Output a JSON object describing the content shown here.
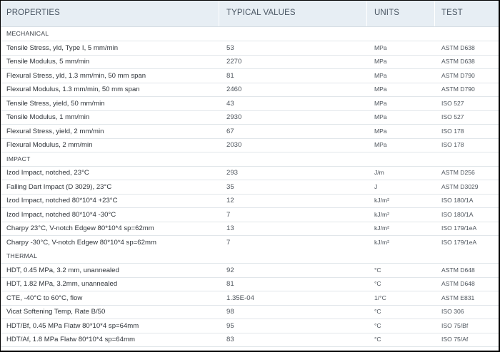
{
  "header": {
    "properties": "PROPERTIES",
    "typical_values": "TYPICAL VALUES",
    "units": "UNITS",
    "test_methods": "TEST METHODS"
  },
  "sections": [
    {
      "name": "MECHANICAL",
      "rows": [
        {
          "property": "Tensile Stress, yld, Type I, 5 mm/min",
          "value": "53",
          "unit": "MPa",
          "method": "ASTM D638"
        },
        {
          "property": "Tensile Modulus, 5 mm/min",
          "value": "2270",
          "unit": "MPa",
          "method": "ASTM D638"
        },
        {
          "property": "Flexural Stress, yld, 1.3 mm/min, 50 mm span",
          "value": "81",
          "unit": "MPa",
          "method": "ASTM D790"
        },
        {
          "property": "Flexural Modulus, 1.3 mm/min, 50 mm span",
          "value": "2460",
          "unit": "MPa",
          "method": "ASTM D790"
        },
        {
          "property": "Tensile Stress, yield, 50 mm/min",
          "value": "43",
          "unit": "MPa",
          "method": "ISO 527"
        },
        {
          "property": "Tensile Modulus, 1 mm/min",
          "value": "2930",
          "unit": "MPa",
          "method": "ISO 527"
        },
        {
          "property": "Flexural Stress, yield, 2 mm/min",
          "value": "67",
          "unit": "MPa",
          "method": "ISO 178"
        },
        {
          "property": "Flexural Modulus, 2 mm/min",
          "value": "2030",
          "unit": "MPa",
          "method": "ISO 178"
        }
      ]
    },
    {
      "name": "IMPACT",
      "rows": [
        {
          "property": "Izod Impact, notched, 23°C",
          "value": "293",
          "unit": "J/m",
          "method": "ASTM D256"
        },
        {
          "property": "Falling Dart Impact (D 3029), 23°C",
          "value": "35",
          "unit": "J",
          "method": "ASTM D3029"
        },
        {
          "property": "Izod Impact, notched 80*10*4 +23°C",
          "value": "12",
          "unit": "kJ/m²",
          "method": "ISO 180/1A"
        },
        {
          "property": "Izod Impact, notched 80*10*4 -30°C",
          "value": "7",
          "unit": "kJ/m²",
          "method": "ISO 180/1A"
        },
        {
          "property": "Charpy 23°C, V-notch Edgew 80*10*4 sp=62mm",
          "value": "13",
          "unit": "kJ/m²",
          "method": "ISO 179/1eA"
        },
        {
          "property": "Charpy -30°C, V-notch Edgew 80*10*4 sp=62mm",
          "value": "7",
          "unit": "kJ/m²",
          "method": "ISO 179/1eA"
        }
      ]
    },
    {
      "name": "THERMAL",
      "rows": [
        {
          "property": "HDT, 0.45 MPa, 3.2 mm, unannealed",
          "value": "92",
          "unit": "°C",
          "method": "ASTM D648"
        },
        {
          "property": "HDT, 1.82 MPa, 3.2mm, unannealed",
          "value": "81",
          "unit": "°C",
          "method": "ASTM D648"
        },
        {
          "property": "CTE, -40°C to 60°C, flow",
          "value": "1.35E-04",
          "unit": "1/°C",
          "method": "ASTM E831"
        },
        {
          "property": "Vicat Softening Temp, Rate B/50",
          "value": "98",
          "unit": "°C",
          "method": "ISO 306"
        },
        {
          "property": "HDT/Bf, 0.45 MPa Flatw 80*10*4 sp=64mm",
          "value": "95",
          "unit": "°C",
          "method": "ISO 75/Bf"
        },
        {
          "property": "HDT/Af, 1.8 MPa Flatw 80*10*4 sp=64mm",
          "value": "83",
          "unit": "°C",
          "method": "ISO 75/Af"
        }
      ]
    }
  ]
}
